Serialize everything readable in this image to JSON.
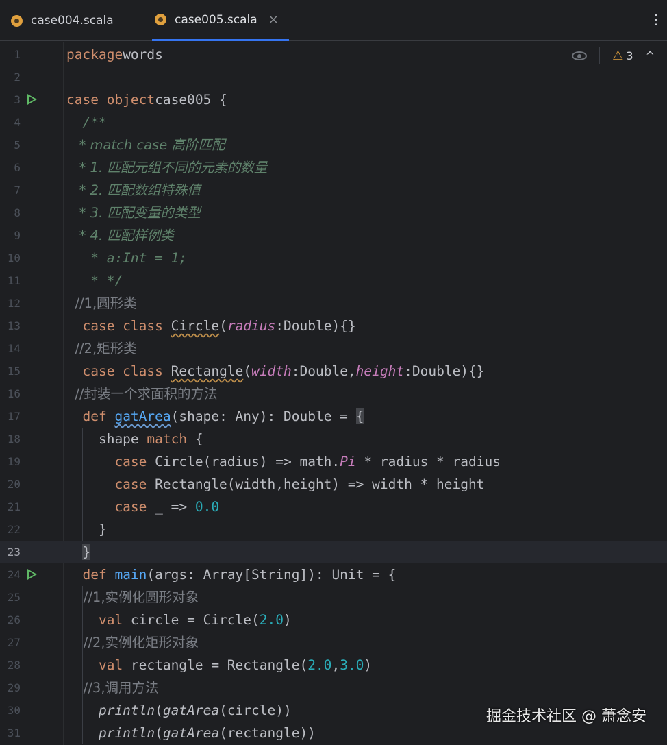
{
  "tabs": [
    {
      "label": "case004.scala",
      "active": false
    },
    {
      "label": "case005.scala",
      "active": true
    }
  ],
  "tab_close_symbol": "×",
  "tab_menu_symbol": "⋮",
  "inspection": {
    "warning_count": "3",
    "warning_icon": "⚠",
    "nav_icon": "^"
  },
  "current_line": 23,
  "lines": [
    {
      "n": "1",
      "run": false,
      "html_key": "l1"
    },
    {
      "n": "2",
      "run": false
    },
    {
      "n": "3",
      "run": true
    },
    {
      "n": "4",
      "run": false
    },
    {
      "n": "5",
      "run": false
    },
    {
      "n": "6",
      "run": false
    },
    {
      "n": "7",
      "run": false
    },
    {
      "n": "8",
      "run": false
    },
    {
      "n": "9",
      "run": false
    },
    {
      "n": "10",
      "run": false
    },
    {
      "n": "11",
      "run": false
    },
    {
      "n": "12",
      "run": false
    },
    {
      "n": "13",
      "run": false
    },
    {
      "n": "14",
      "run": false
    },
    {
      "n": "15",
      "run": false
    },
    {
      "n": "16",
      "run": false
    },
    {
      "n": "17",
      "run": false
    },
    {
      "n": "18",
      "run": false
    },
    {
      "n": "19",
      "run": false
    },
    {
      "n": "20",
      "run": false
    },
    {
      "n": "21",
      "run": false
    },
    {
      "n": "22",
      "run": false
    },
    {
      "n": "23",
      "run": false
    },
    {
      "n": "24",
      "run": true
    },
    {
      "n": "25",
      "run": false
    },
    {
      "n": "26",
      "run": false
    },
    {
      "n": "27",
      "run": false
    },
    {
      "n": "28",
      "run": false
    },
    {
      "n": "29",
      "run": false
    },
    {
      "n": "30",
      "run": false
    },
    {
      "n": "31",
      "run": false
    }
  ],
  "code": {
    "l1": [
      [
        "kw",
        "package"
      ],
      [
        "",
        "words"
      ]
    ],
    "l2": [],
    "l3": [
      [
        "kw",
        "case object"
      ],
      [
        "",
        "case005 {"
      ]
    ],
    "l4": [
      [
        "doc",
        "  /**"
      ]
    ],
    "l5": [
      [
        "doc",
        "   * match case 高阶匹配"
      ]
    ],
    "l6": [
      [
        "doc",
        "   * 1. 匹配元组不同的元素的数量"
      ]
    ],
    "l7": [
      [
        "doc",
        "   * 2. 匹配数组特殊值"
      ]
    ],
    "l8": [
      [
        "doc",
        "   * 3. 匹配变量的类型"
      ]
    ],
    "l9": [
      [
        "doc",
        "   * 4. 匹配样例类"
      ]
    ],
    "l10": [
      [
        "doc",
        "   * a:Int = 1;"
      ]
    ],
    "l11": [
      [
        "doc",
        "   * */"
      ]
    ],
    "l12": [
      [
        "cm",
        "  //1,圆形类"
      ]
    ],
    "l13": [
      [
        "kw",
        "  case class "
      ],
      [
        "wavy",
        "Circle"
      ],
      [
        "",
        "("
      ],
      [
        "param",
        "radius"
      ],
      [
        "",
        ":Double){}"
      ]
    ],
    "l14": [
      [
        "cm",
        "  //2,矩形类"
      ]
    ],
    "l15": [
      [
        "kw",
        "  case class "
      ],
      [
        "wavy",
        "Rectangle"
      ],
      [
        "",
        "("
      ],
      [
        "param",
        "width"
      ],
      [
        "",
        ":Double,"
      ],
      [
        "param",
        "height"
      ],
      [
        "",
        ":Double){}"
      ]
    ],
    "l16": [
      [
        "cm",
        "  //封装一个求面积的方法"
      ]
    ],
    "l17": [
      [
        "kw",
        "  def "
      ],
      [
        "fn wavy-blue",
        "gatArea"
      ],
      [
        "",
        "(shape: Any): Double = "
      ],
      [
        "hl",
        "{"
      ]
    ],
    "l18": [
      [
        "",
        "    shape "
      ],
      [
        "kw",
        "match"
      ],
      [
        "",
        " {"
      ]
    ],
    "l19": [
      [
        "kw",
        "      case "
      ],
      [
        "",
        "Circle(radius) => math."
      ],
      [
        "pi",
        "Pi"
      ],
      [
        "",
        " * radius * radius"
      ]
    ],
    "l20": [
      [
        "kw",
        "      case "
      ],
      [
        "",
        "Rectangle(width,height) => width * height"
      ]
    ],
    "l21": [
      [
        "kw",
        "      case "
      ],
      [
        "",
        "_ => "
      ],
      [
        "num",
        "0.0"
      ]
    ],
    "l22": [
      [
        "",
        "    }"
      ]
    ],
    "l23": [
      [
        "",
        "  "
      ],
      [
        "hl",
        "}"
      ]
    ],
    "l24": [
      [
        "kw",
        "  def "
      ],
      [
        "fn",
        "main"
      ],
      [
        "",
        "(args: Array[String]): Unit = {"
      ]
    ],
    "l25": [
      [
        "cm",
        "    //1,实例化圆形对象"
      ]
    ],
    "l26": [
      [
        "kw",
        "    val "
      ],
      [
        "",
        "circle = Circle("
      ],
      [
        "num",
        "2.0"
      ],
      [
        "",
        ")"
      ]
    ],
    "l27": [
      [
        "cm",
        "    //2,实例化矩形对象"
      ]
    ],
    "l28": [
      [
        "kw",
        "    val "
      ],
      [
        "",
        "rectangle = Rectangle("
      ],
      [
        "num",
        "2.0"
      ],
      [
        "",
        ","
      ],
      [
        "num",
        "3.0"
      ],
      [
        "",
        ")"
      ]
    ],
    "l29": [
      [
        "cm",
        "    //3,调用方法"
      ]
    ],
    "l30": [
      [
        "st",
        "    println"
      ],
      [
        "",
        "("
      ],
      [
        "st",
        "gatArea"
      ],
      [
        "",
        "(circle))"
      ]
    ],
    "l31": [
      [
        "st",
        "    println"
      ],
      [
        "",
        "("
      ],
      [
        "st",
        "gatArea"
      ],
      [
        "",
        "(rectangle))"
      ]
    ]
  },
  "watermark": "掘金技术社区 @ 萧念安"
}
